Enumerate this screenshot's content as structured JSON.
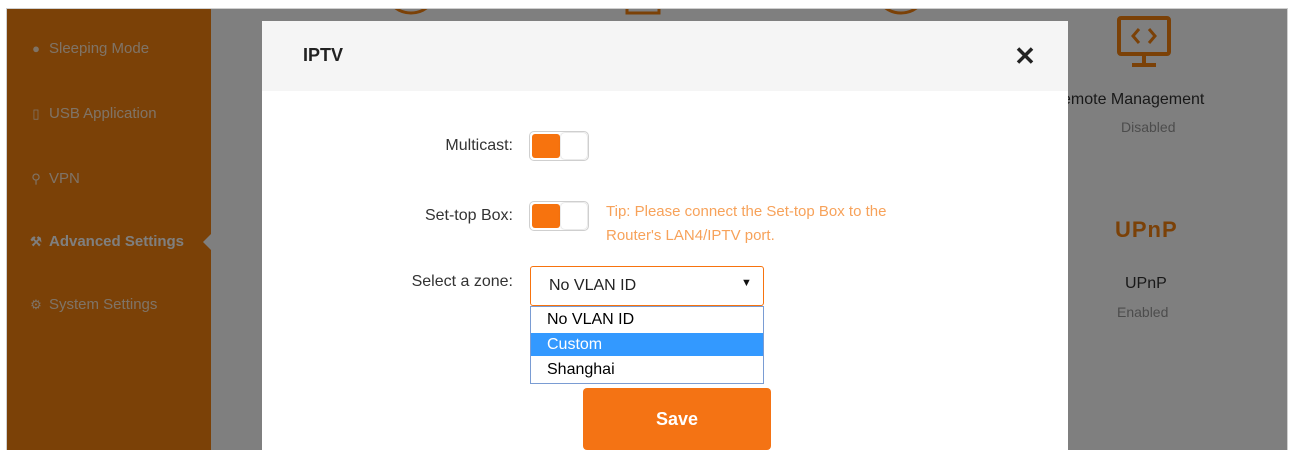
{
  "sidebar": {
    "items": [
      {
        "label": "Sleeping Mode",
        "icon": "bulb-icon"
      },
      {
        "label": "USB Application",
        "icon": "usb-icon"
      },
      {
        "label": "VPN",
        "icon": "vpn-icon"
      },
      {
        "label": "Advanced Settings",
        "icon": "wrench-icon"
      },
      {
        "label": "System Settings",
        "icon": "gear-icon"
      }
    ],
    "active_label": "Advanced Settings"
  },
  "tiles": {
    "remote_management": {
      "title": "emote Management",
      "status": "Disabled",
      "icon": "monitor-code-icon"
    },
    "upnp": {
      "title": "UPnP",
      "status": "Enabled",
      "logo_text": "UPnP",
      "icon": "upnp-logo"
    }
  },
  "modal": {
    "title": "IPTV",
    "close_label": "✕",
    "multicast": {
      "label": "Multicast:",
      "enabled": true
    },
    "settop": {
      "label": "Set-top Box:",
      "enabled": true,
      "tip_line1": "Tip: Please connect the Set-top Box to the",
      "tip_line2": "Router's LAN4/IPTV port."
    },
    "zone": {
      "label": "Select a zone:",
      "value": "No VLAN ID",
      "arrow": "▼",
      "options": [
        "No VLAN ID",
        "Custom",
        "Shanghai"
      ],
      "highlighted": "Custom"
    },
    "save_label": "Save"
  },
  "colors": {
    "accent": "#f7820f",
    "button": "#f47314",
    "tip": "#f7a25a",
    "highlight": "#3399ff"
  }
}
